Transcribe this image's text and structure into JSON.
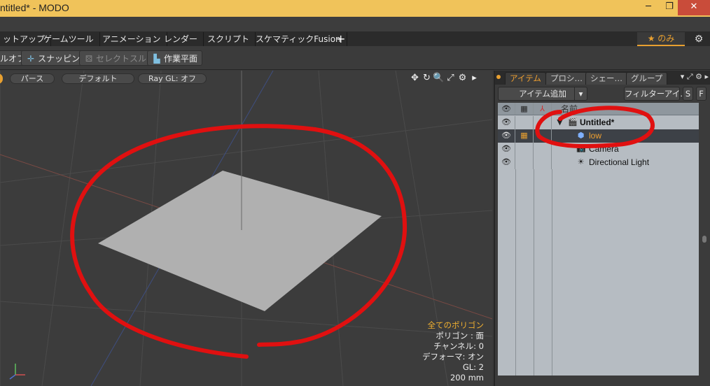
{
  "window": {
    "title": "ntitled* - MODO",
    "minimize": "─",
    "restore": "❐",
    "close": "✕"
  },
  "tabs": [
    {
      "label": "ットアップ"
    },
    {
      "label": "ゲームツール"
    },
    {
      "label": "アニメーション"
    },
    {
      "label": "レンダー"
    },
    {
      "label": "スクリプト"
    },
    {
      "label": "スケマティックFusion"
    }
  ],
  "tabs_extra": {
    "plus": "+",
    "star_only": "★  のみ",
    "gear": "⚙"
  },
  "toolbar": {
    "off_label": "ルオフ",
    "snapping_label": "スナッピング",
    "select_through_label": "セレクトスルー",
    "work_plane_label": "作業平面"
  },
  "viewport": {
    "view_mode": "パース",
    "shading": "デフォルト",
    "raygl": "Ray GL: オフ",
    "icons": [
      "✥",
      "↻",
      "🔍",
      "⤢",
      "⚙",
      "▸"
    ],
    "info": {
      "all_polygons": "全てのポリゴン",
      "polygon": "ポリゴン : 面",
      "channel": "チャンネル: 0",
      "deformer": "デフォーマ: オン",
      "gl": "GL: 2",
      "grid": "200 mm"
    }
  },
  "panel": {
    "tabs": [
      {
        "label": "アイテム"
      },
      {
        "label": "プロシ…"
      },
      {
        "label": "シェー…"
      },
      {
        "label": "グループ"
      }
    ],
    "add_item": "アイテム追加",
    "filter": "フィルターアイ…",
    "s_button": "S",
    "f_button": "F",
    "header_label": "名前",
    "items": [
      {
        "label": "Untitled*"
      },
      {
        "label": "low"
      },
      {
        "label": "Camera"
      },
      {
        "label": "Directional Light"
      }
    ]
  },
  "colors": {
    "title_bar": "#f0c35a",
    "accent": "#f0a030",
    "annotation": "#e01010"
  }
}
